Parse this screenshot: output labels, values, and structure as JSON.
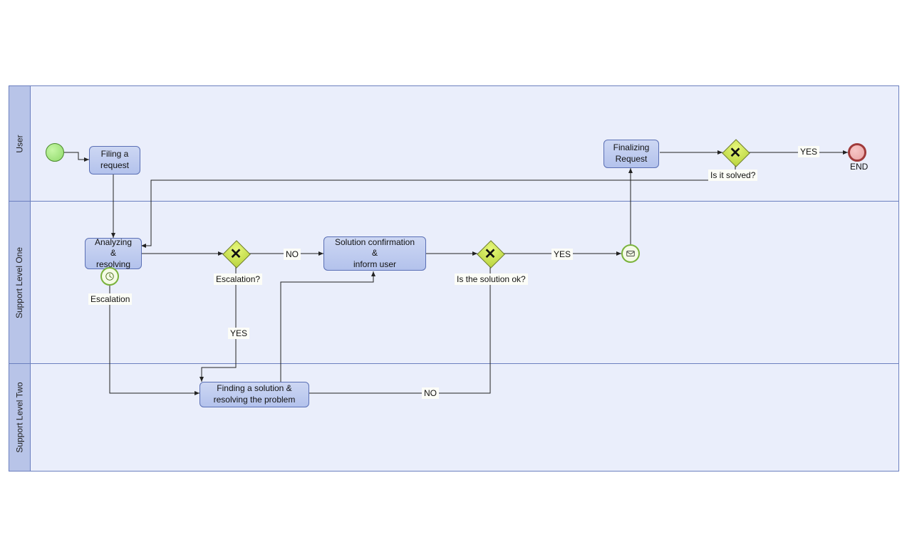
{
  "lanes": {
    "user": "User",
    "l1": "Support Level One",
    "l2": "Support Level Two"
  },
  "tasks": {
    "filing": "Filing a\nrequest",
    "analyzing": "Analyzing &\nresolving",
    "solution": "Solution confirmation\n&\ninform user",
    "finding": "Finding a solution &\nresolving the problem",
    "finalizing": "Finalizing\nRequest"
  },
  "gateways": {
    "escalation": "Escalation?",
    "solution_ok": "Is the solution ok?",
    "solved": "Is it solved?"
  },
  "events": {
    "escalation_timer": "Escalation",
    "end": "END"
  },
  "edges": {
    "no1": "NO",
    "yes1": "YES",
    "yes2": "YES",
    "no2": "NO",
    "yes3": "YES"
  }
}
